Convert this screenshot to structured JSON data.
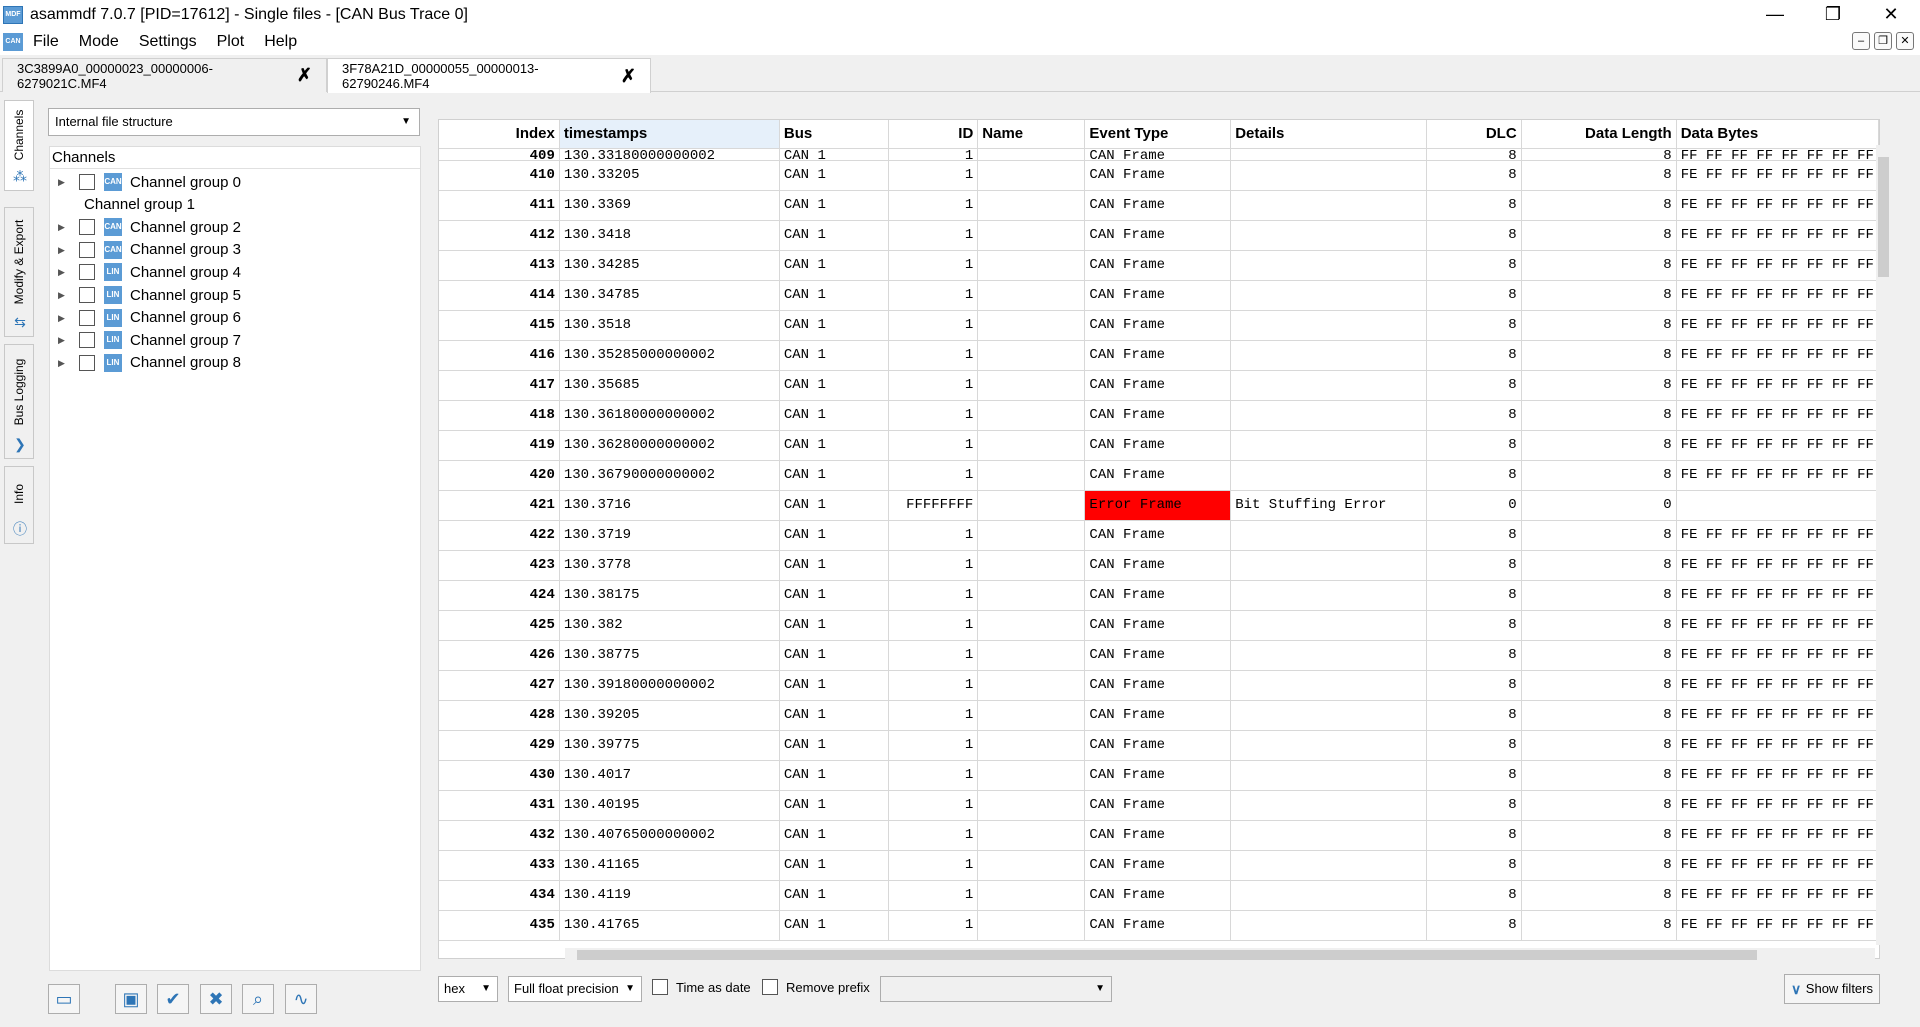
{
  "window": {
    "title": "asammdf 7.0.7 [PID=17612] - Single files - [CAN Bus Trace 0]",
    "minimize": "—",
    "maximize": "❐",
    "close": "✕"
  },
  "menu": {
    "items": [
      "File",
      "Mode",
      "Settings",
      "Plot",
      "Help"
    ]
  },
  "tabs": [
    {
      "label": "3C3899A0_00000023_00000006-6279021C.MF4"
    },
    {
      "label": "3F78A21D_00000055_00000013-62790246.MF4"
    }
  ],
  "side_tabs": [
    "Channels",
    "Modify & Export",
    "Bus Logging",
    "Info"
  ],
  "left": {
    "combo": "Internal file structure",
    "tree_header": "Channels",
    "groups": [
      {
        "label": "Channel group 0",
        "icon": "CAN",
        "has_children": true,
        "has_checkbox": true
      },
      {
        "label": "Channel group 1",
        "icon": "",
        "has_children": false,
        "has_checkbox": false
      },
      {
        "label": "Channel group 2",
        "icon": "CAN",
        "has_children": true,
        "has_checkbox": true
      },
      {
        "label": "Channel group 3",
        "icon": "CAN",
        "has_children": true,
        "has_checkbox": true
      },
      {
        "label": "Channel group 4",
        "icon": "LIN",
        "has_children": true,
        "has_checkbox": true
      },
      {
        "label": "Channel group 5",
        "icon": "LIN",
        "has_children": true,
        "has_checkbox": true
      },
      {
        "label": "Channel group 6",
        "icon": "LIN",
        "has_children": true,
        "has_checkbox": true
      },
      {
        "label": "Channel group 7",
        "icon": "LIN",
        "has_children": true,
        "has_checkbox": true
      },
      {
        "label": "Channel group 8",
        "icon": "LIN",
        "has_children": true,
        "has_checkbox": true
      }
    ]
  },
  "table": {
    "columns": [
      "Index",
      "timestamps",
      "Bus",
      "ID",
      "Name",
      "Event Type",
      "Details",
      "DLC",
      "Data Length",
      "Data Bytes"
    ],
    "rows": [
      [
        "409",
        "130.33180000000002",
        "CAN 1",
        "1",
        "",
        "CAN Frame",
        "",
        "8",
        "8",
        "FF FF FF FF FF FF FF FF"
      ],
      [
        "410",
        "130.33205",
        "CAN 1",
        "1",
        "",
        "CAN Frame",
        "",
        "8",
        "8",
        "FE FF FF FF FF FF FF FF"
      ],
      [
        "411",
        "130.3369",
        "CAN 1",
        "1",
        "",
        "CAN Frame",
        "",
        "8",
        "8",
        "FE FF FF FF FF FF FF FF"
      ],
      [
        "412",
        "130.3418",
        "CAN 1",
        "1",
        "",
        "CAN Frame",
        "",
        "8",
        "8",
        "FE FF FF FF FF FF FF FF"
      ],
      [
        "413",
        "130.34285",
        "CAN 1",
        "1",
        "",
        "CAN Frame",
        "",
        "8",
        "8",
        "FE FF FF FF FF FF FF FF"
      ],
      [
        "414",
        "130.34785",
        "CAN 1",
        "1",
        "",
        "CAN Frame",
        "",
        "8",
        "8",
        "FE FF FF FF FF FF FF FF"
      ],
      [
        "415",
        "130.3518",
        "CAN 1",
        "1",
        "",
        "CAN Frame",
        "",
        "8",
        "8",
        "FE FF FF FF FF FF FF FF"
      ],
      [
        "416",
        "130.35285000000002",
        "CAN 1",
        "1",
        "",
        "CAN Frame",
        "",
        "8",
        "8",
        "FE FF FF FF FF FF FF FF"
      ],
      [
        "417",
        "130.35685",
        "CAN 1",
        "1",
        "",
        "CAN Frame",
        "",
        "8",
        "8",
        "FE FF FF FF FF FF FF FF"
      ],
      [
        "418",
        "130.36180000000002",
        "CAN 1",
        "1",
        "",
        "CAN Frame",
        "",
        "8",
        "8",
        "FE FF FF FF FF FF FF FF"
      ],
      [
        "419",
        "130.36280000000002",
        "CAN 1",
        "1",
        "",
        "CAN Frame",
        "",
        "8",
        "8",
        "FE FF FF FF FF FF FF FF"
      ],
      [
        "420",
        "130.36790000000002",
        "CAN 1",
        "1",
        "",
        "CAN Frame",
        "",
        "8",
        "8",
        "FE FF FF FF FF FF FF FF"
      ],
      [
        "421",
        "130.3716",
        "CAN 1",
        "FFFFFFFF",
        "",
        "Error Frame",
        "Bit Stuffing Error",
        "0",
        "0",
        ""
      ],
      [
        "422",
        "130.3719",
        "CAN 1",
        "1",
        "",
        "CAN Frame",
        "",
        "8",
        "8",
        "FE FF FF FF FF FF FF FF"
      ],
      [
        "423",
        "130.3778",
        "CAN 1",
        "1",
        "",
        "CAN Frame",
        "",
        "8",
        "8",
        "FE FF FF FF FF FF FF FF"
      ],
      [
        "424",
        "130.38175",
        "CAN 1",
        "1",
        "",
        "CAN Frame",
        "",
        "8",
        "8",
        "FE FF FF FF FF FF FF FF"
      ],
      [
        "425",
        "130.382",
        "CAN 1",
        "1",
        "",
        "CAN Frame",
        "",
        "8",
        "8",
        "FE FF FF FF FF FF FF FF"
      ],
      [
        "426",
        "130.38775",
        "CAN 1",
        "1",
        "",
        "CAN Frame",
        "",
        "8",
        "8",
        "FE FF FF FF FF FF FF FF"
      ],
      [
        "427",
        "130.39180000000002",
        "CAN 1",
        "1",
        "",
        "CAN Frame",
        "",
        "8",
        "8",
        "FE FF FF FF FF FF FF FF"
      ],
      [
        "428",
        "130.39205",
        "CAN 1",
        "1",
        "",
        "CAN Frame",
        "",
        "8",
        "8",
        "FE FF FF FF FF FF FF FF"
      ],
      [
        "429",
        "130.39775",
        "CAN 1",
        "1",
        "",
        "CAN Frame",
        "",
        "8",
        "8",
        "FE FF FF FF FF FF FF FF"
      ],
      [
        "430",
        "130.4017",
        "CAN 1",
        "1",
        "",
        "CAN Frame",
        "",
        "8",
        "8",
        "FE FF FF FF FF FF FF FF"
      ],
      [
        "431",
        "130.40195",
        "CAN 1",
        "1",
        "",
        "CAN Frame",
        "",
        "8",
        "8",
        "FE FF FF FF FF FF FF FF"
      ],
      [
        "432",
        "130.40765000000002",
        "CAN 1",
        "1",
        "",
        "CAN Frame",
        "",
        "8",
        "8",
        "FE FF FF FF FF FF FF FF"
      ],
      [
        "433",
        "130.41165",
        "CAN 1",
        "1",
        "",
        "CAN Frame",
        "",
        "8",
        "8",
        "FE FF FF FF FF FF FF FF"
      ],
      [
        "434",
        "130.4119",
        "CAN 1",
        "1",
        "",
        "CAN Frame",
        "",
        "8",
        "8",
        "FE FF FF FF FF FF FF FF"
      ],
      [
        "435",
        "130.41765",
        "CAN 1",
        "1",
        "",
        "CAN Frame",
        "",
        "8",
        "8",
        "FE FF FF FF FF FF FF FF"
      ]
    ],
    "error_color": "#ff0000"
  },
  "bottom": {
    "format": "hex",
    "precision": "Full float precision",
    "time_as_date": "Time as date",
    "remove_prefix": "Remove prefix",
    "show_filters": "Show filters"
  },
  "toolbar_icons": [
    "open-folder-icon",
    "save-icon",
    "check-icon",
    "delete-icon",
    "search-icon",
    "plot-icon"
  ],
  "colors": {
    "accent": "#2e75b6",
    "error": "#ff0000"
  }
}
